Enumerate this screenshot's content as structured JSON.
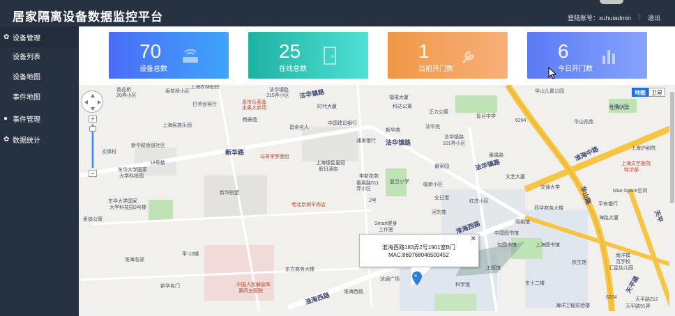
{
  "header": {
    "title": "居家隔离设备数据监控平台",
    "account": "登陆账号：xuhuiadmin",
    "separator": "|",
    "logout": "退出"
  },
  "sidebar": {
    "groups": [
      {
        "label": "设备管理",
        "icon": "gear-icon",
        "items": [
          "设备列表",
          "设备地图",
          "事件地图"
        ]
      },
      {
        "label": "事件管理",
        "icon": "user-icon",
        "items": []
      },
      {
        "label": "数据统计",
        "icon": "gear-icon",
        "items": []
      }
    ]
  },
  "stats": [
    {
      "value": "70",
      "label": "设备总数",
      "icon": "router-icon",
      "color": "#4b6cf6"
    },
    {
      "value": "25",
      "label": "在线总数",
      "icon": "door-icon",
      "color": "#1fb2a3"
    },
    {
      "value": "1",
      "label": "当前开门数",
      "icon": "wrench-icon",
      "color": "#f09747"
    },
    {
      "value": "6",
      "label": "今日开门数",
      "icon": "bar-chart-icon",
      "color": "#5a7af6"
    }
  ],
  "map": {
    "type_buttons": [
      "地图",
      "卫星"
    ],
    "infowindow": {
      "address": "淮海西路183弄2号1901室B门",
      "mac": "MAC:869768046500452"
    },
    "labels": {
      "l1": "香花桥",
      "l2": "20弄小区",
      "l3": "香花桥小区",
      "l4": "上海农林职校",
      "l5": "法华镇路",
      "l6": "315弄小区",
      "l7": "巴爷会客厅",
      "l8": "喜市乐荟晶",
      "l9": "水果大卖场",
      "l10": "时代大厦",
      "l11": "上海民族乐团",
      "l12": "畅豪苑",
      "l13": "昌余名人",
      "l14": "中国建设银行",
      "l15": "浦发银行",
      "l16": "法华镇路",
      "l17": "新华路街道社区",
      "l18": "文缘村",
      "l19": "18号楼",
      "l20": "东华大学国家",
      "l21": "大学科技园",
      "l22": "新华路",
      "l23": "马哥李罗面包",
      "l24": "上海银星皇冠",
      "l25": "假日酒店",
      "l26": "申新花苑",
      "l27": "番禺路511",
      "l28": "弄小区",
      "l29": "复旦小学",
      "l30": "新华别墅",
      "l31": "老北京涮羊肉店",
      "l32": "2号",
      "l33": "Smart健身",
      "l34": "工作室",
      "l35": "东华大学国家",
      "l36": "大学科技园3号楼",
      "l37": "爱迪公寓",
      "l38": "淮海西路",
      "l39": "东方商务大楼",
      "l40": "中国人民解放军",
      "l41": "第四五医院",
      "l42": "达通广场",
      "l43": "科学馆",
      "l44": "淮海名邸",
      "l45": "新华名门",
      "l46": "甲-12幢",
      "l47": "福禧大厦",
      "l48": "科达公寓",
      "l49": "正力公寓",
      "l50": "复旦中学",
      "l51": "法华苑",
      "l52": "法华镇路",
      "l53": "101弄小区",
      "l54": "法华镇路",
      "l55": "番家园",
      "l56": "新华苑",
      "l57": "临新小区",
      "l58": "全日港",
      "l59": "红庄小区",
      "l60": "河东苑",
      "l61": "文艺大厦",
      "l62": "交通大学",
      "l63": "中国图书馆",
      "l64": "番禺路",
      "l65": "西华商务大楼",
      "l66": "上海图书馆",
      "l67": "华山儿童公园",
      "l68": "华山花苑",
      "l69": "淮海中路",
      "l70": "上海文艺医院",
      "l71": "上海大学",
      "l72": "Mao Space空间",
      "l73": "平安银行",
      "l74": "海路大厦",
      "l75": "南洋模",
      "l76": "范学校",
      "l77": "汇星幼儿园",
      "l78": "天平路",
      "l79": "华山路",
      "l80": "海洋工程实验楼",
      "l81": "天平路212",
      "l82": "天平路91弄",
      "l83": "东十二楼",
      "l84": "铁生馆",
      "l85": "工程馆",
      "l86": "包图书馆",
      "l87": "照相馆",
      "l88": "上海沪剧院",
      "l89": "特诊部",
      "l90": "淮海西路",
      "l91": "法华镇路",
      "l92": "淮海西路",
      "l93": "6204",
      "l94": "6204",
      "l95": "泰谭小区",
      "l96": "天平"
    }
  }
}
